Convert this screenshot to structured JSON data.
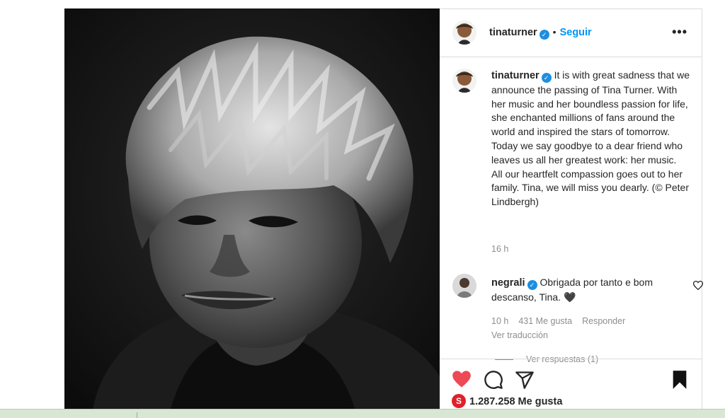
{
  "post": {
    "username": "tinaturner",
    "follow_label": "Seguir",
    "separator": "•",
    "more_label": "•••",
    "caption_user": "tinaturner",
    "caption": "It is with great sadness that we announce the passing of Tina Turner. With her music and her boundless passion for life, she enchanted millions of fans around the world and inspired the stars of tomorrow. Today we say goodbye to a dear friend who leaves us all her greatest work: her music. All our heartfelt compassion goes out to her family. Tina, we will miss you dearly. (© Peter Lindbergh)",
    "time": "16 h",
    "likes": "1.287.258 Me gusta",
    "like_badge": "S"
  },
  "comment": {
    "username": "negrali",
    "text": "Obrigada por tanto e bom descanso, Tina. 🖤",
    "time": "10 h",
    "likes": "431 Me gusta",
    "reply_label": "Responder",
    "translate_label": "Ver traducción",
    "view_replies": "Ver respuestas (1)"
  },
  "icons": {
    "like": "heart-filled-icon",
    "comment": "comment-bubble-icon",
    "share": "paper-plane-icon",
    "save": "bookmark-filled-icon",
    "comment_like": "heart-outline-icon",
    "verified": "verified-badge-icon"
  },
  "colors": {
    "accent_blue": "#0095f6",
    "verified_blue": "#1d8fe1",
    "like_red": "#ed4956",
    "text_secondary": "#8e8e8e"
  }
}
